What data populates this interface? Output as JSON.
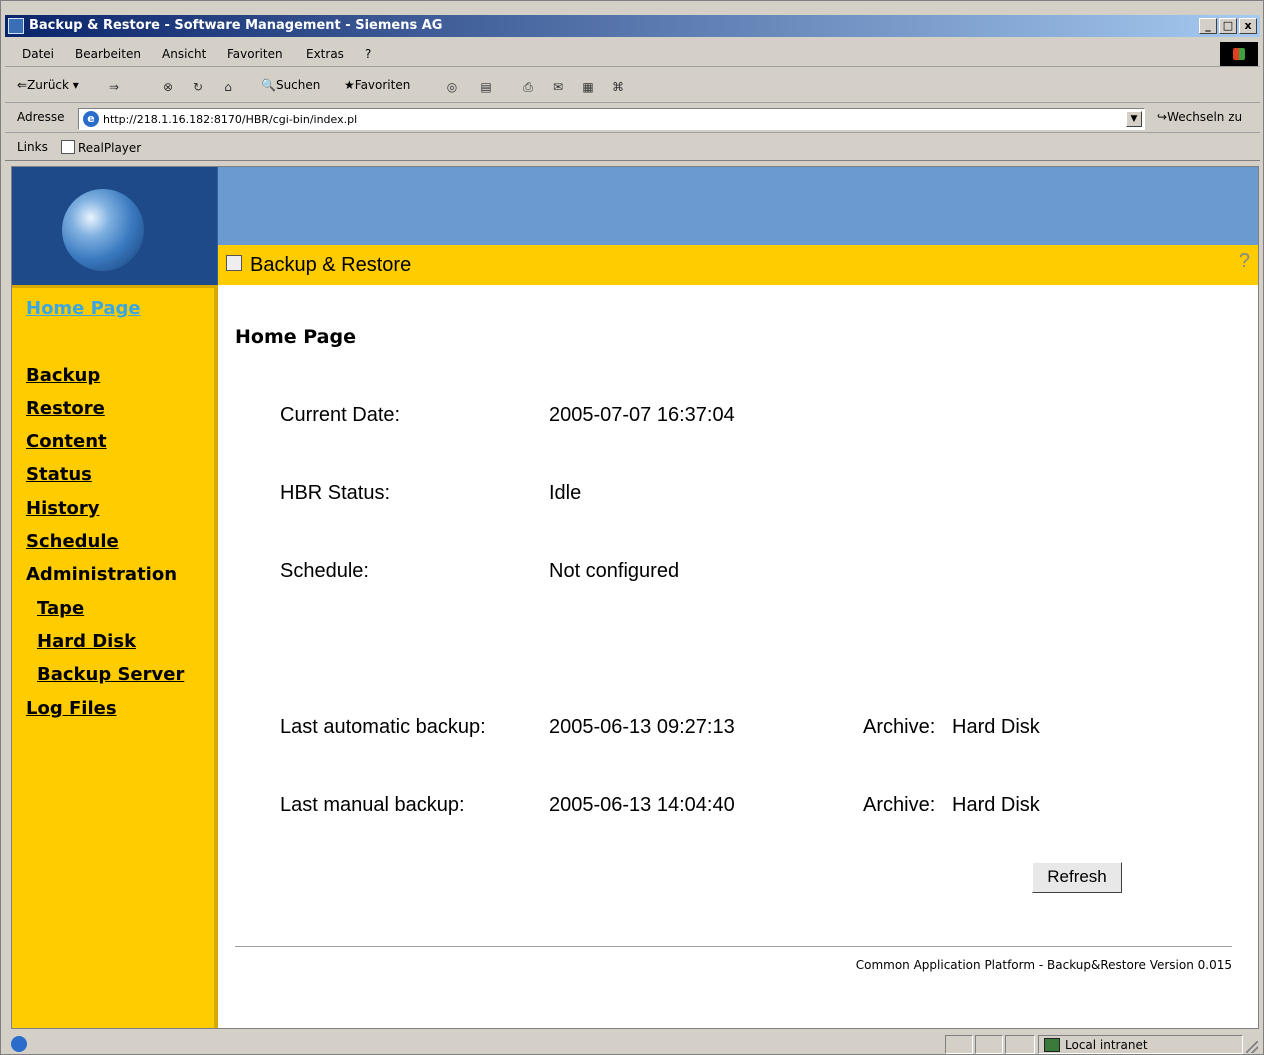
{
  "window": {
    "title": "Backup & Restore - Software Management - Siemens AG",
    "min_label": "_",
    "max_label": "□",
    "close_label": "x"
  },
  "menu": [
    "Datei",
    "Bearbeiten",
    "Ansicht",
    "Favoriten",
    "Extras",
    "?"
  ],
  "toolbar": {
    "back_label": "Zurück",
    "search_label": "Suchen",
    "favorites_label": "Favoriten"
  },
  "address": {
    "label": "Adresse",
    "url": "http://218.1.16.182:8170/HBR/cgi-bin/index.pl",
    "go_label": "Wechseln zu"
  },
  "links": {
    "label": "Links",
    "items": [
      "RealPlayer"
    ]
  },
  "app": {
    "header_title": "Backup & Restore",
    "help_label": "?"
  },
  "sidebar": {
    "items": [
      {
        "label": "Home Page"
      },
      {
        "label": "Backup"
      },
      {
        "label": "Restore"
      },
      {
        "label": "Content"
      },
      {
        "label": "Status"
      },
      {
        "label": "History"
      },
      {
        "label": "Schedule"
      },
      {
        "label": "Administration"
      },
      {
        "label": "Tape"
      },
      {
        "label": "Hard Disk"
      },
      {
        "label": "Backup Server"
      },
      {
        "label": "Log Files"
      }
    ]
  },
  "main": {
    "page_title": "Home Page",
    "current_date_label": "Current Date:",
    "current_date_value": "2005-07-07 16:37:04",
    "hbr_status_label": "HBR Status:",
    "hbr_status_value": "Idle",
    "schedule_label": "Schedule:",
    "schedule_value": "Not configured",
    "last_auto_label": "Last automatic backup:",
    "last_auto_value": "2005-06-13 09:27:13",
    "last_auto_archive_label": "Archive:",
    "last_auto_archive_value": "Hard Disk",
    "last_manual_label": "Last manual backup:",
    "last_manual_value": "2005-06-13 14:04:40",
    "last_manual_archive_label": "Archive:",
    "last_manual_archive_value": "Hard Disk",
    "refresh_label": "Refresh",
    "footer": "Common Application Platform - Backup&Restore Version 0.015"
  },
  "status": {
    "zone": "Local intranet"
  },
  "colors": {
    "sidebar_bg": "#ffcc00",
    "banner_bg": "#6a9ad0",
    "active_link": "#3aa7e0",
    "titlebar": "#0a246a"
  }
}
